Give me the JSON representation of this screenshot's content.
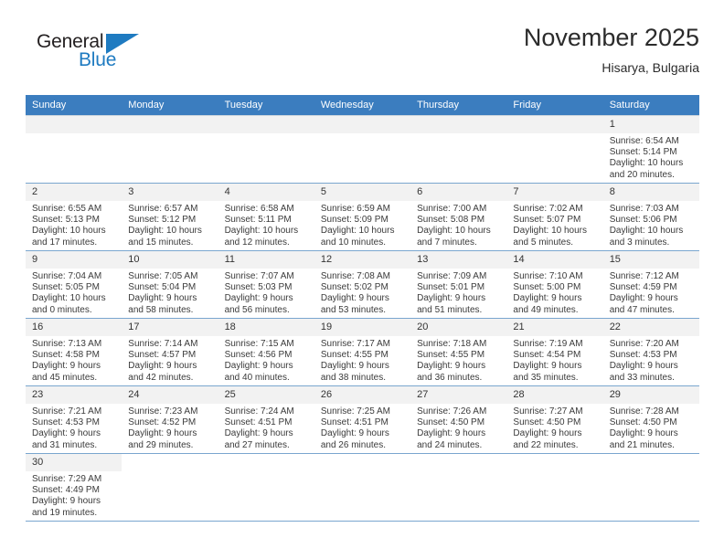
{
  "brand": {
    "name_top": "General",
    "name_bottom": "Blue",
    "color_primary": "#1f7bc1",
    "color_dark": "#231f20"
  },
  "header": {
    "title": "November 2025",
    "subtitle": "Hisarya, Bulgaria",
    "header_bg": "#3b7dbf",
    "header_text_color": "#ffffff"
  },
  "weekdays": [
    "Sunday",
    "Monday",
    "Tuesday",
    "Wednesday",
    "Thursday",
    "Friday",
    "Saturday"
  ],
  "weeks": [
    [
      {
        "day": "",
        "empty": true
      },
      {
        "day": "",
        "empty": true
      },
      {
        "day": "",
        "empty": true
      },
      {
        "day": "",
        "empty": true
      },
      {
        "day": "",
        "empty": true
      },
      {
        "day": "",
        "empty": true
      },
      {
        "day": "1",
        "sunrise": "Sunrise: 6:54 AM",
        "sunset": "Sunset: 5:14 PM",
        "daylight": "Daylight: 10 hours and 20 minutes."
      }
    ],
    [
      {
        "day": "2",
        "sunrise": "Sunrise: 6:55 AM",
        "sunset": "Sunset: 5:13 PM",
        "daylight": "Daylight: 10 hours and 17 minutes."
      },
      {
        "day": "3",
        "sunrise": "Sunrise: 6:57 AM",
        "sunset": "Sunset: 5:12 PM",
        "daylight": "Daylight: 10 hours and 15 minutes."
      },
      {
        "day": "4",
        "sunrise": "Sunrise: 6:58 AM",
        "sunset": "Sunset: 5:11 PM",
        "daylight": "Daylight: 10 hours and 12 minutes."
      },
      {
        "day": "5",
        "sunrise": "Sunrise: 6:59 AM",
        "sunset": "Sunset: 5:09 PM",
        "daylight": "Daylight: 10 hours and 10 minutes."
      },
      {
        "day": "6",
        "sunrise": "Sunrise: 7:00 AM",
        "sunset": "Sunset: 5:08 PM",
        "daylight": "Daylight: 10 hours and 7 minutes."
      },
      {
        "day": "7",
        "sunrise": "Sunrise: 7:02 AM",
        "sunset": "Sunset: 5:07 PM",
        "daylight": "Daylight: 10 hours and 5 minutes."
      },
      {
        "day": "8",
        "sunrise": "Sunrise: 7:03 AM",
        "sunset": "Sunset: 5:06 PM",
        "daylight": "Daylight: 10 hours and 3 minutes."
      }
    ],
    [
      {
        "day": "9",
        "sunrise": "Sunrise: 7:04 AM",
        "sunset": "Sunset: 5:05 PM",
        "daylight": "Daylight: 10 hours and 0 minutes."
      },
      {
        "day": "10",
        "sunrise": "Sunrise: 7:05 AM",
        "sunset": "Sunset: 5:04 PM",
        "daylight": "Daylight: 9 hours and 58 minutes."
      },
      {
        "day": "11",
        "sunrise": "Sunrise: 7:07 AM",
        "sunset": "Sunset: 5:03 PM",
        "daylight": "Daylight: 9 hours and 56 minutes."
      },
      {
        "day": "12",
        "sunrise": "Sunrise: 7:08 AM",
        "sunset": "Sunset: 5:02 PM",
        "daylight": "Daylight: 9 hours and 53 minutes."
      },
      {
        "day": "13",
        "sunrise": "Sunrise: 7:09 AM",
        "sunset": "Sunset: 5:01 PM",
        "daylight": "Daylight: 9 hours and 51 minutes."
      },
      {
        "day": "14",
        "sunrise": "Sunrise: 7:10 AM",
        "sunset": "Sunset: 5:00 PM",
        "daylight": "Daylight: 9 hours and 49 minutes."
      },
      {
        "day": "15",
        "sunrise": "Sunrise: 7:12 AM",
        "sunset": "Sunset: 4:59 PM",
        "daylight": "Daylight: 9 hours and 47 minutes."
      }
    ],
    [
      {
        "day": "16",
        "sunrise": "Sunrise: 7:13 AM",
        "sunset": "Sunset: 4:58 PM",
        "daylight": "Daylight: 9 hours and 45 minutes."
      },
      {
        "day": "17",
        "sunrise": "Sunrise: 7:14 AM",
        "sunset": "Sunset: 4:57 PM",
        "daylight": "Daylight: 9 hours and 42 minutes."
      },
      {
        "day": "18",
        "sunrise": "Sunrise: 7:15 AM",
        "sunset": "Sunset: 4:56 PM",
        "daylight": "Daylight: 9 hours and 40 minutes."
      },
      {
        "day": "19",
        "sunrise": "Sunrise: 7:17 AM",
        "sunset": "Sunset: 4:55 PM",
        "daylight": "Daylight: 9 hours and 38 minutes."
      },
      {
        "day": "20",
        "sunrise": "Sunrise: 7:18 AM",
        "sunset": "Sunset: 4:55 PM",
        "daylight": "Daylight: 9 hours and 36 minutes."
      },
      {
        "day": "21",
        "sunrise": "Sunrise: 7:19 AM",
        "sunset": "Sunset: 4:54 PM",
        "daylight": "Daylight: 9 hours and 35 minutes."
      },
      {
        "day": "22",
        "sunrise": "Sunrise: 7:20 AM",
        "sunset": "Sunset: 4:53 PM",
        "daylight": "Daylight: 9 hours and 33 minutes."
      }
    ],
    [
      {
        "day": "23",
        "sunrise": "Sunrise: 7:21 AM",
        "sunset": "Sunset: 4:53 PM",
        "daylight": "Daylight: 9 hours and 31 minutes."
      },
      {
        "day": "24",
        "sunrise": "Sunrise: 7:23 AM",
        "sunset": "Sunset: 4:52 PM",
        "daylight": "Daylight: 9 hours and 29 minutes."
      },
      {
        "day": "25",
        "sunrise": "Sunrise: 7:24 AM",
        "sunset": "Sunset: 4:51 PM",
        "daylight": "Daylight: 9 hours and 27 minutes."
      },
      {
        "day": "26",
        "sunrise": "Sunrise: 7:25 AM",
        "sunset": "Sunset: 4:51 PM",
        "daylight": "Daylight: 9 hours and 26 minutes."
      },
      {
        "day": "27",
        "sunrise": "Sunrise: 7:26 AM",
        "sunset": "Sunset: 4:50 PM",
        "daylight": "Daylight: 9 hours and 24 minutes."
      },
      {
        "day": "28",
        "sunrise": "Sunrise: 7:27 AM",
        "sunset": "Sunset: 4:50 PM",
        "daylight": "Daylight: 9 hours and 22 minutes."
      },
      {
        "day": "29",
        "sunrise": "Sunrise: 7:28 AM",
        "sunset": "Sunset: 4:50 PM",
        "daylight": "Daylight: 9 hours and 21 minutes."
      }
    ],
    [
      {
        "day": "30",
        "sunrise": "Sunrise: 7:29 AM",
        "sunset": "Sunset: 4:49 PM",
        "daylight": "Daylight: 9 hours and 19 minutes."
      },
      {
        "day": "",
        "empty": true,
        "blank": true
      },
      {
        "day": "",
        "empty": true,
        "blank": true
      },
      {
        "day": "",
        "empty": true,
        "blank": true
      },
      {
        "day": "",
        "empty": true,
        "blank": true
      },
      {
        "day": "",
        "empty": true,
        "blank": true
      },
      {
        "day": "",
        "empty": true,
        "blank": true
      }
    ]
  ]
}
